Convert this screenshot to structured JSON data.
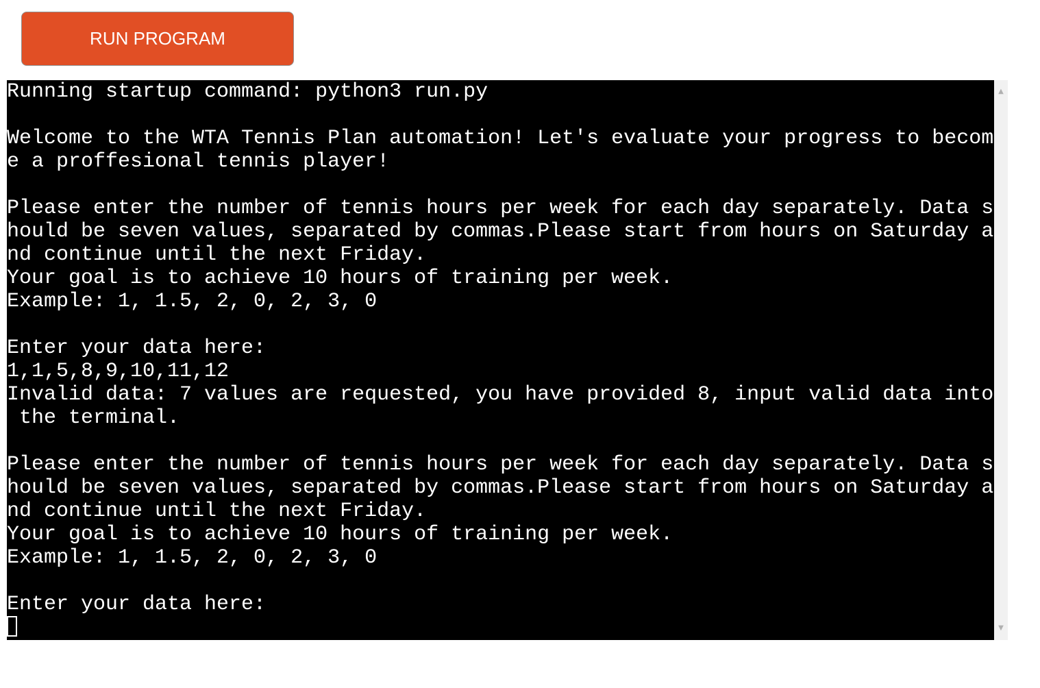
{
  "toolbar": {
    "run_label": "RUN PROGRAM"
  },
  "terminal": {
    "lines": [
      "Running startup command: python3 run.py",
      "",
      "Welcome to the WTA Tennis Plan automation! Let's evaluate your progress to becom",
      "e a proffesional tennis player!",
      "",
      "Please enter the number of tennis hours per week for each day separately. Data s",
      "hould be seven values, separated by commas.Please start from hours on Saturday a",
      "nd continue until the next Friday.",
      "Your goal is to achieve 10 hours of training per week.",
      "Example: 1, 1.5, 2, 0, 2, 3, 0",
      "",
      "Enter your data here:",
      "1,1,5,8,9,10,11,12",
      "Invalid data: 7 values are requested, you have provided 8, input valid data into",
      " the terminal.",
      "",
      "Please enter the number of tennis hours per week for each day separately. Data s",
      "hould be seven values, separated by commas.Please start from hours on Saturday a",
      "nd continue until the next Friday.",
      "Your goal is to achieve 10 hours of training per week.",
      "Example: 1, 1.5, 2, 0, 2, 3, 0",
      "",
      "Enter your data here:"
    ]
  },
  "scrollbar": {
    "up_icon": "triangle-up-icon",
    "down_icon": "triangle-down-icon"
  }
}
